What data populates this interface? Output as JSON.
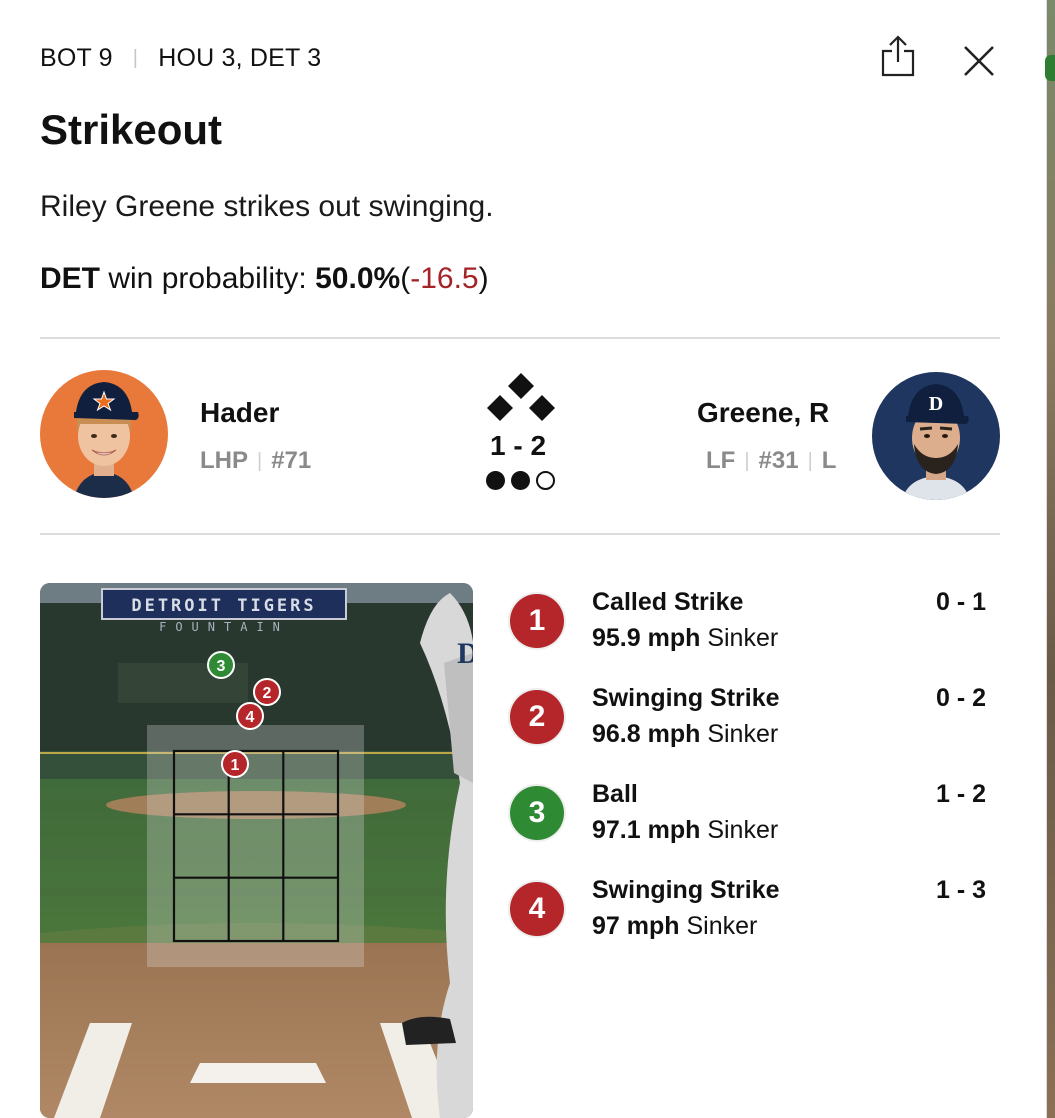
{
  "header": {
    "inning": "BOT 9",
    "score": "HOU 3, DET 3"
  },
  "play": {
    "title": "Strikeout",
    "description": "Riley Greene strikes out swinging.",
    "win_team": "DET",
    "win_label": "win probability:",
    "win_value": "50.0%",
    "open_paren": "(",
    "win_delta": "-16.5",
    "close_paren": ")"
  },
  "pitcher": {
    "name": "Hader",
    "hand": "LHP",
    "number": "#71",
    "cap_logo": "astros-star"
  },
  "batter": {
    "name": "Greene, R",
    "position": "LF",
    "number": "#31",
    "bats": "L",
    "cap_logo": "tigers-D"
  },
  "situation": {
    "count": "1 - 2",
    "outs": 2,
    "outs_max": 3,
    "bases_occupied": []
  },
  "zone_background": {
    "sign_line1": "DETROIT TIGERS",
    "sign_line2": "FOUNTAIN"
  },
  "pitches": [
    {
      "num": "1",
      "result": "Called Strike",
      "speed": "95.9 mph",
      "type": "Sinker",
      "count": "0 - 1",
      "color": "#b5262b"
    },
    {
      "num": "2",
      "result": "Swinging Strike",
      "speed": "96.8 mph",
      "type": "Sinker",
      "count": "0 - 2",
      "color": "#b5262b"
    },
    {
      "num": "3",
      "result": "Ball",
      "speed": "97.1 mph",
      "type": "Sinker",
      "count": "1 - 2",
      "color": "#2f8a34"
    },
    {
      "num": "4",
      "result": "Swinging Strike",
      "speed": "97 mph",
      "type": "Sinker",
      "count": "1 - 3",
      "color": "#b5262b"
    }
  ],
  "icons": {
    "share": "share-icon",
    "close": "close-icon"
  },
  "colors": {
    "strike": "#b5262b",
    "ball": "#2f8a34",
    "delta_negative": "#a32327"
  }
}
